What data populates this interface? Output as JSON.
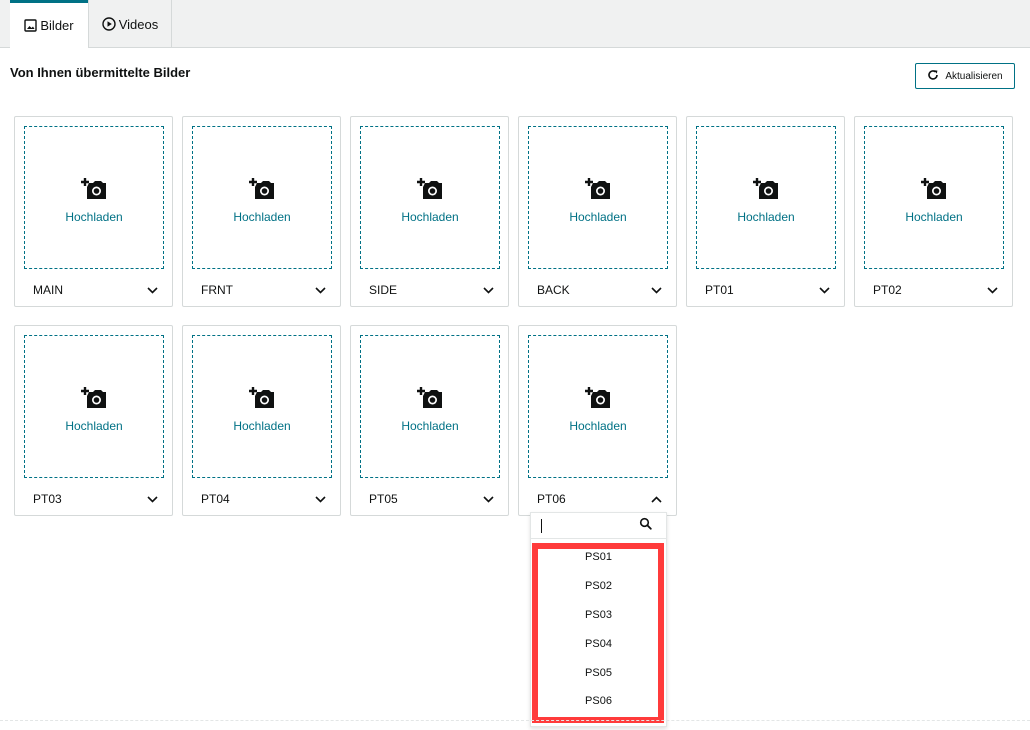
{
  "tabs": [
    {
      "label": "Bilder",
      "icon": "image-icon",
      "active": true
    },
    {
      "label": "Videos",
      "icon": "play-circle-icon",
      "active": false
    }
  ],
  "section": {
    "title": "Von Ihnen übermittelte Bilder"
  },
  "toolbar": {
    "refresh_label": "Aktualisieren",
    "refresh_icon": "refresh-icon"
  },
  "upload_label": "Hochladen",
  "slots": [
    {
      "label": "MAIN",
      "expanded": false
    },
    {
      "label": "FRNT",
      "expanded": false
    },
    {
      "label": "SIDE",
      "expanded": false
    },
    {
      "label": "BACK",
      "expanded": false
    },
    {
      "label": "PT01",
      "expanded": false
    },
    {
      "label": "PT02",
      "expanded": false
    },
    {
      "label": "PT03",
      "expanded": false
    },
    {
      "label": "PT04",
      "expanded": false
    },
    {
      "label": "PT05",
      "expanded": false
    },
    {
      "label": "PT06",
      "expanded": true
    }
  ],
  "dropdown": {
    "search_value": "",
    "options": [
      "PS01",
      "PS02",
      "PS03",
      "PS04",
      "PS05",
      "PS06"
    ]
  },
  "colors": {
    "accent": "#007185",
    "highlight": "#ff3b3b"
  }
}
